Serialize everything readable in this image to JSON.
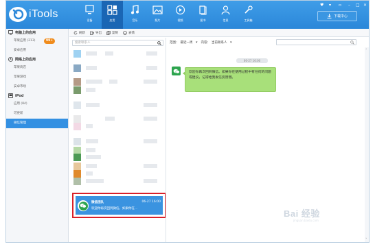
{
  "app": {
    "brand": "iTools"
  },
  "nav": [
    {
      "label": "设备",
      "icon": "device-icon",
      "active": false
    },
    {
      "label": "应用",
      "icon": "apps-icon",
      "active": true
    },
    {
      "label": "音乐",
      "icon": "music-icon",
      "active": false
    },
    {
      "label": "照片",
      "icon": "photo-icon",
      "active": false
    },
    {
      "label": "视频",
      "icon": "video-icon",
      "active": false
    },
    {
      "label": "图书",
      "icon": "book-icon",
      "active": false
    },
    {
      "label": "信息",
      "icon": "contact-icon",
      "active": false
    },
    {
      "label": "工具箱",
      "icon": "tools-icon",
      "active": false
    }
  ],
  "download": {
    "label": "下载中心"
  },
  "sidebar": {
    "computer": {
      "title": "电脑上的应用",
      "items": [
        {
          "label": "苹果应用 (213)",
          "badge": "99+"
        },
        {
          "label": "安卓应用"
        }
      ]
    },
    "network": {
      "title": "网络上的应用",
      "items": [
        {
          "label": "苹果商店"
        },
        {
          "label": "苹果游戏"
        },
        {
          "label": "安卓市场"
        }
      ]
    },
    "ipod": {
      "title": "iPod",
      "items": [
        {
          "label": "应用 (84)"
        },
        {
          "label": "可更新"
        },
        {
          "label": "微信管理"
        }
      ]
    }
  },
  "toolbar": {
    "refresh": "刷新",
    "export": "导出",
    "copy": "复制",
    "emoji": "表情"
  },
  "list": {
    "search_placeholder": "搜索联系人",
    "highlighted": {
      "name": "微信团队",
      "time": "06-27 16:00",
      "preview": "欢迎你再次回到微信。如果你在..."
    }
  },
  "filter": {
    "range_label": "范围：",
    "range_value": "最近一周",
    "content_label": "内容：",
    "content_value": "当前联系人"
  },
  "chat": {
    "time": "06-27 16:00",
    "message": "欢迎你再次回到微信。如果你在使用过程中有任何的问题或建议，记得给我发信反馈哦。"
  },
  "watermark": {
    "text": "Bai 经验",
    "sub": "jingyan.baidu.com"
  },
  "colors": {
    "topbar": "#2b87d9",
    "nav_active": "#1a66b4",
    "selected": "#3390e2",
    "badge": "#f08c1d",
    "bubble": "#a8e07a",
    "highlight_border": "#d92029",
    "wechat_green": "#2da44e"
  }
}
